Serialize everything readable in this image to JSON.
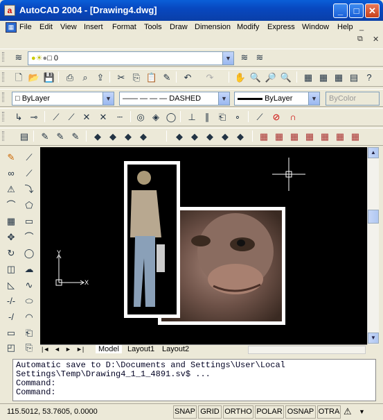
{
  "window": {
    "app_icon": "a",
    "title": "AutoCAD 2004 - [Drawing4.dwg]"
  },
  "menubar": {
    "items": [
      "File",
      "Edit",
      "View",
      "Insert",
      "Format",
      "Tools",
      "Draw",
      "Dimension",
      "Modify",
      "Express",
      "Window",
      "Help"
    ],
    "doc_icon": "document-icon"
  },
  "layers": {
    "current_layer": "0"
  },
  "properties": {
    "color": "ByLayer",
    "linetype": "DASHED",
    "lineweight": "ByLayer",
    "plotstyle": "ByColor"
  },
  "layout_tabs": [
    "Model",
    "Layout1",
    "Layout2"
  ],
  "command_window": {
    "lines": [
      "Automatic save to D:\\Documents and Settings\\User\\Local",
      "Settings\\Temp\\Drawing4_1_1_4891.sv$ ...",
      "Command:"
    ],
    "prompt": "Command:"
  },
  "status": {
    "coords": "115.5012, 53.7605, 0.0000",
    "toggles": [
      "SNAP",
      "GRID",
      "ORTHO",
      "POLAR",
      "OSNAP",
      "OTRA"
    ]
  },
  "ucs": {
    "x_label": "X",
    "y_label": "Y"
  }
}
